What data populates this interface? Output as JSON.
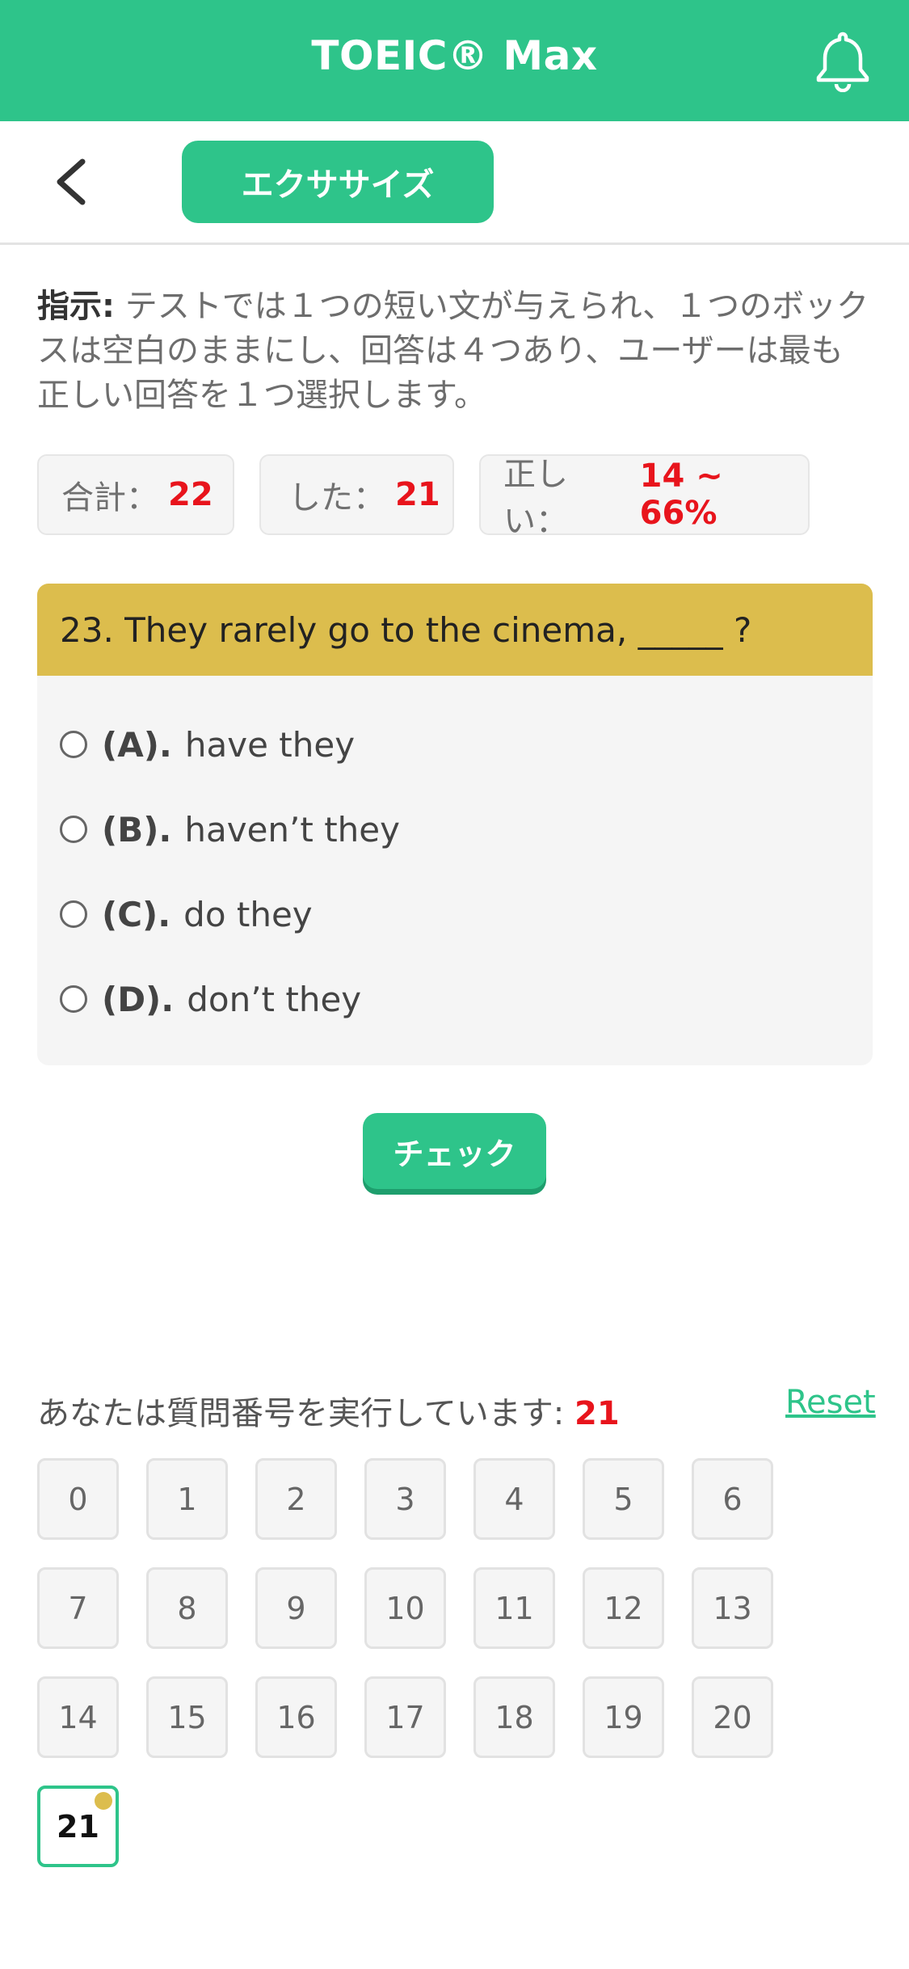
{
  "header": {
    "title": "TOEIC® Max",
    "bell_icon": "bell-icon",
    "brand_color": "#2ec48a"
  },
  "subbar": {
    "back_icon": "chevron-left-icon",
    "tab_label": "エクササイズ"
  },
  "instructions": {
    "label": "指示:",
    "text": " テストでは１つの短い文が与えられ、１つのボックスは空白のままにし、回答は４つあり、ユーザーは最も正しい回答を１つ選択します。"
  },
  "stats": [
    {
      "label": "合計：",
      "value": "22"
    },
    {
      "label": "した：",
      "value": "21"
    },
    {
      "label": "正しい：",
      "value": "14 ~ 66%"
    }
  ],
  "question": {
    "text": "23. They rarely go to the cinema, _____ ?",
    "options": [
      {
        "letter": "(A).",
        "text": "have they"
      },
      {
        "letter": "(B).",
        "text": "haven’t they"
      },
      {
        "letter": "(C).",
        "text": "do they"
      },
      {
        "letter": "(D).",
        "text": "don’t they"
      }
    ]
  },
  "check_label": "チェック",
  "progress": {
    "label": "あなたは質問番号を実行しています: ",
    "current": "21",
    "reset_label": "Reset"
  },
  "numbers": [
    "0",
    "1",
    "2",
    "3",
    "4",
    "5",
    "6",
    "7",
    "8",
    "9",
    "10",
    "11",
    "12",
    "13",
    "14",
    "15",
    "16",
    "17",
    "18",
    "19",
    "20",
    "21"
  ],
  "current_number": "21",
  "colors": {
    "accent": "#2ec48a",
    "question_header": "#dcbd4d",
    "highlight": "#e8141c"
  }
}
